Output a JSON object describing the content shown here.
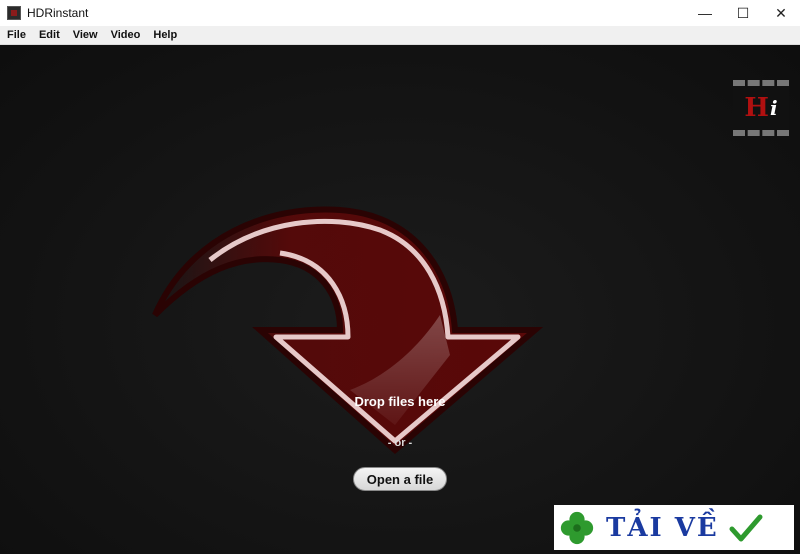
{
  "window": {
    "title": "HDRinstant",
    "controls": {
      "minimize": "—",
      "maximize": "☐",
      "close": "✕"
    }
  },
  "menu": [
    "File",
    "Edit",
    "View",
    "Video",
    "Help"
  ],
  "drop_zone": {
    "drop_text": "Drop files here",
    "or_text": "- or -",
    "open_button": "Open a file",
    "arrow_color": "#5a0808"
  },
  "logo": {
    "letter1": "H",
    "letter2": "i"
  },
  "watermark": {
    "text": "TẢI VỀ"
  },
  "colors": {
    "background": "#141414",
    "accent": "#8a1b1b"
  }
}
